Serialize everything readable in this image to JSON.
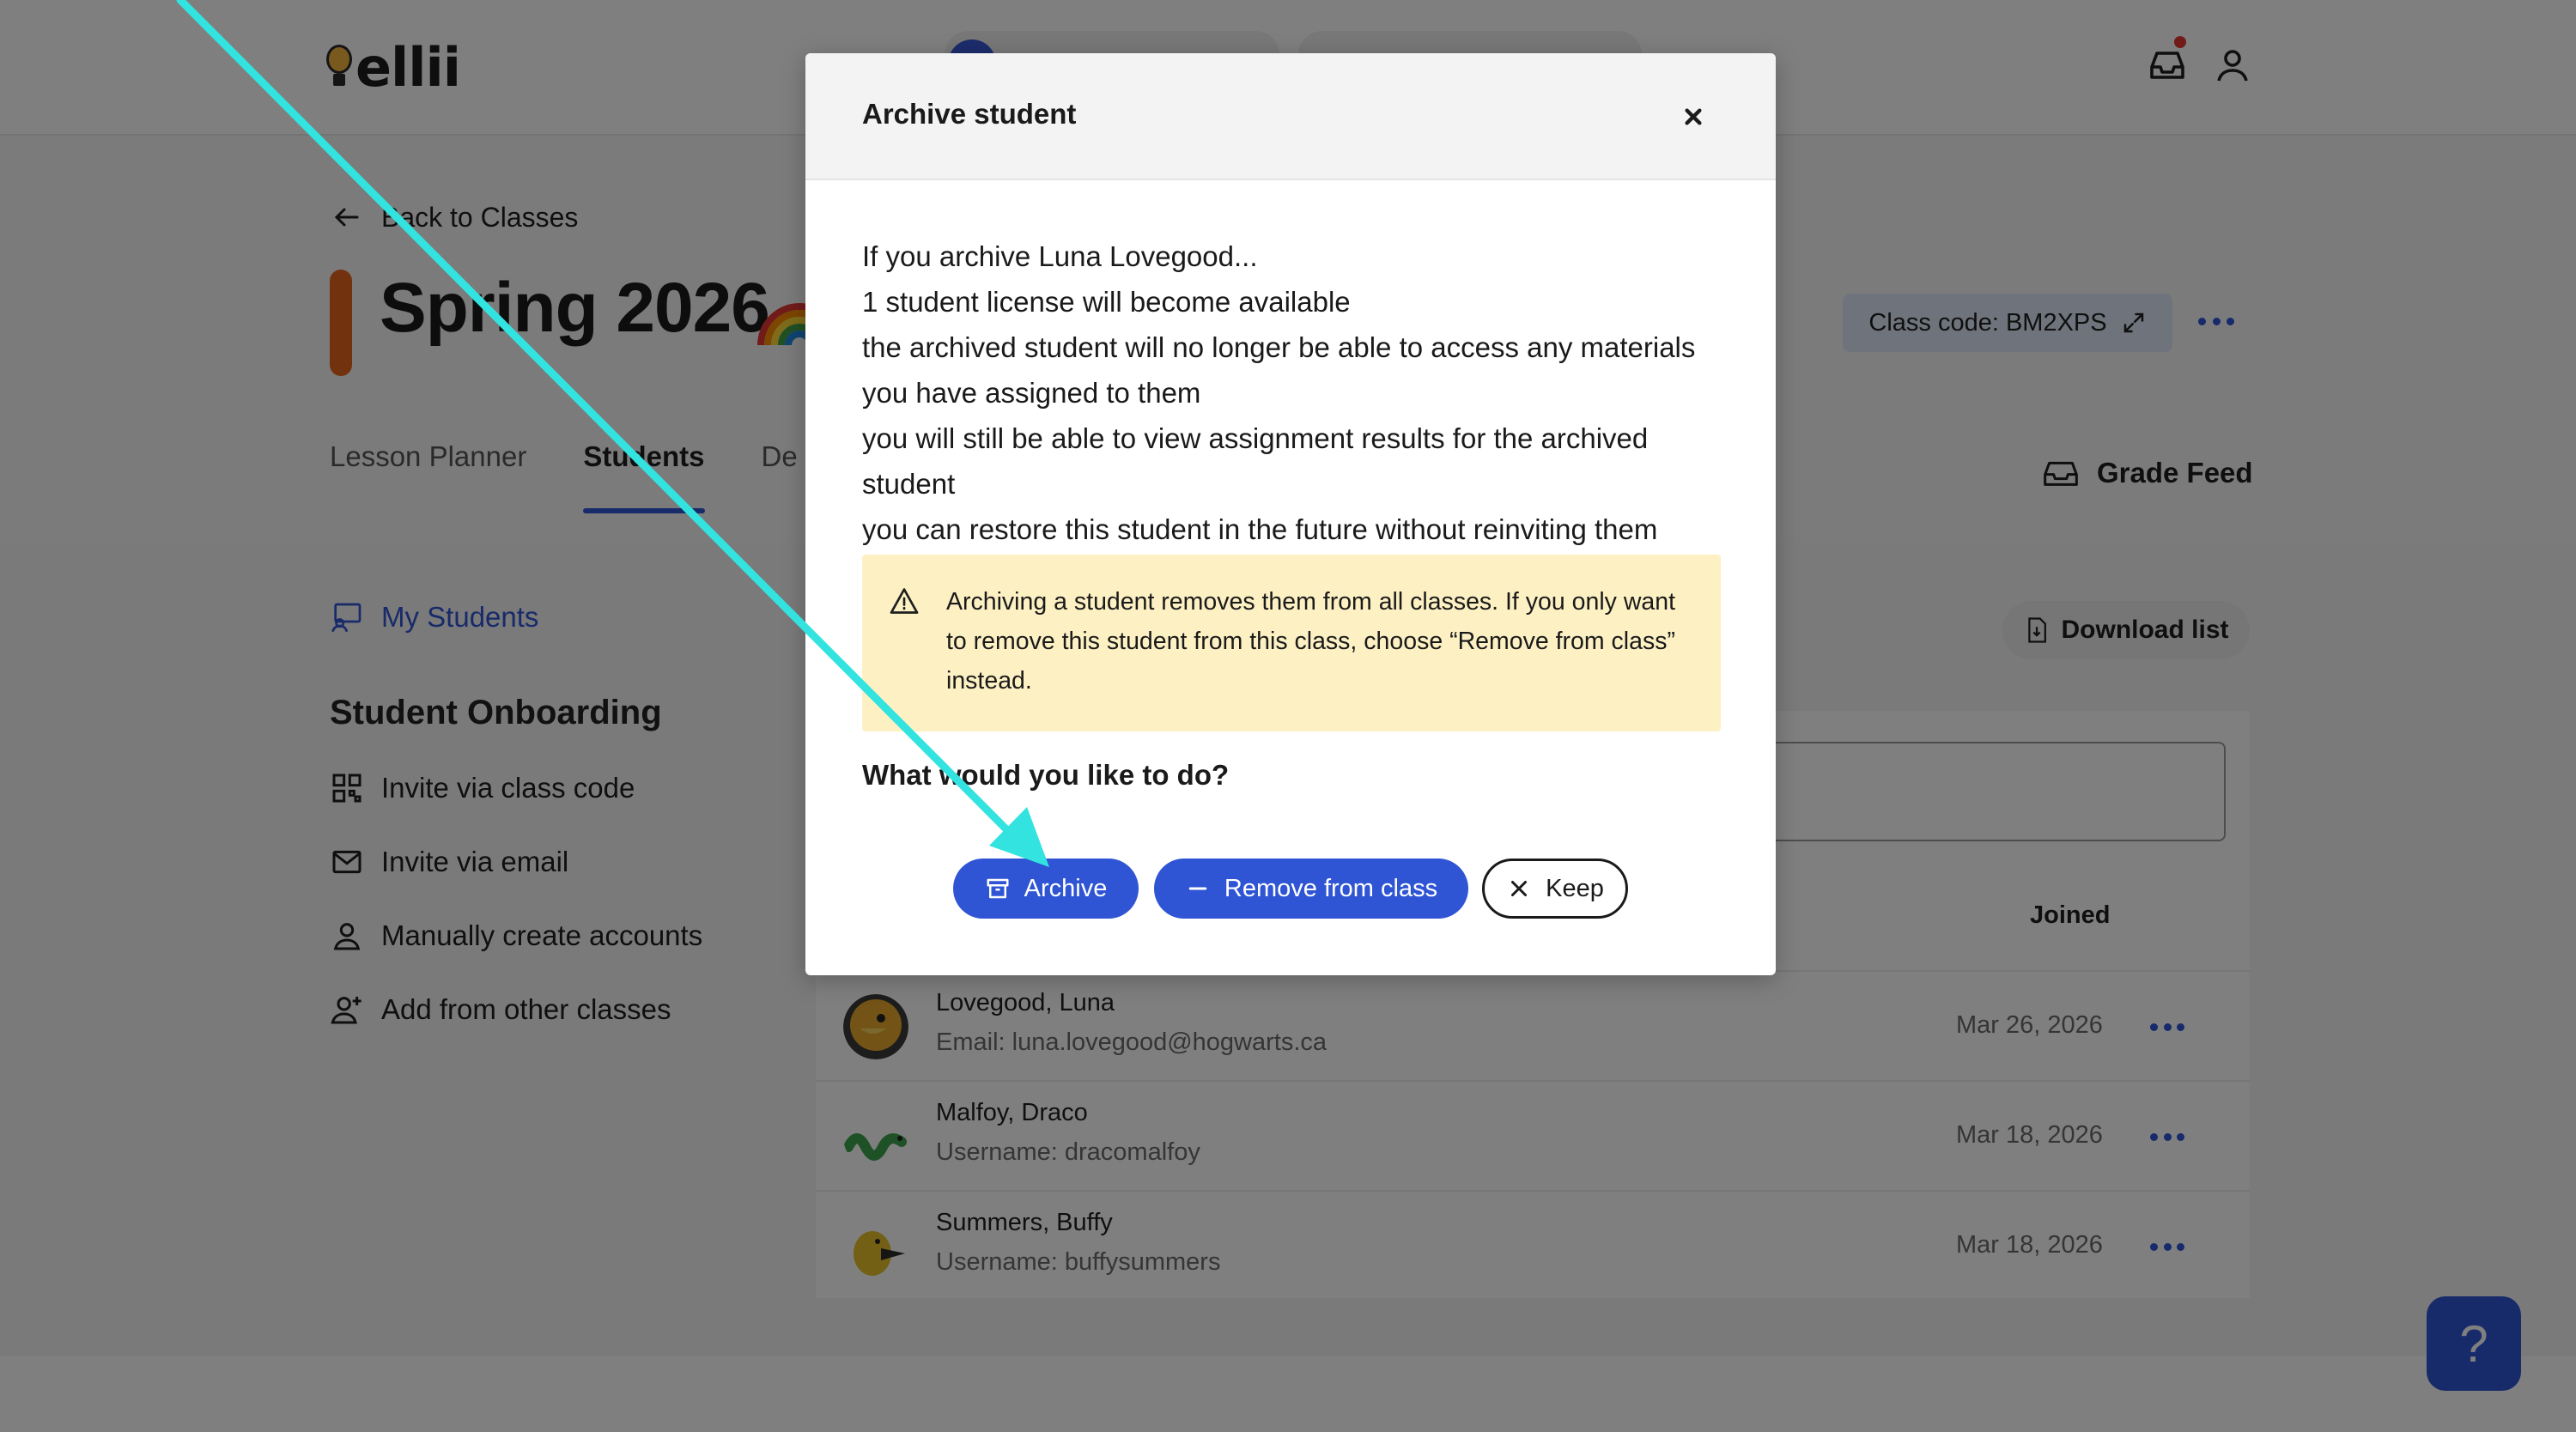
{
  "app": {
    "logo_text": "ellii"
  },
  "header": {
    "back_label": "Back to Classes",
    "class_title": "Spring 2026",
    "class_code_label": "Class code: BM2XPS",
    "grade_feed_label": "Grade Feed"
  },
  "tabs": [
    {
      "label": "Lesson Planner",
      "active": false
    },
    {
      "label": "Students",
      "active": true
    },
    {
      "label": "De",
      "active": false
    }
  ],
  "sidebar": {
    "my_students": "My Students",
    "onboarding_title": "Student Onboarding",
    "items": [
      {
        "label": "Invite via class code",
        "icon": "qr-code-icon"
      },
      {
        "label": "Invite via email",
        "icon": "envelope-icon"
      },
      {
        "label": "Manually create accounts",
        "icon": "person-icon"
      },
      {
        "label": "Add from other classes",
        "icon": "person-add-icon"
      }
    ]
  },
  "students_panel": {
    "download_label": "Download list",
    "joined_header": "Joined",
    "rows": [
      {
        "name": "Lovegood, Luna",
        "sub": "Email: luna.lovegood@hogwarts.ca",
        "date": "Mar 26, 2026",
        "avatar_color": "#e8a82c"
      },
      {
        "name": "Malfoy, Draco",
        "sub": "Username: dracomalfoy",
        "date": "Mar 18, 2026",
        "avatar_color": "#3fa34d"
      },
      {
        "name": "Summers, Buffy",
        "sub": "Username: buffysummers",
        "date": "Mar 18, 2026",
        "avatar_color": "#e6c12b"
      }
    ]
  },
  "help_label": "?",
  "modal": {
    "title": "Archive student",
    "lines": [
      "If you archive Luna Lovegood...",
      "1 student license will become available",
      "the archived student will no longer be able to access any materials you have assigned to them",
      "you will still be able to view assignment results for the archived student",
      "you can restore this student in the future without reinviting them"
    ],
    "warning": "Archiving a student removes them from all classes. If you only want to remove this student from this class, choose “Remove from class” instead.",
    "prompt": "What would you like to do?",
    "buttons": {
      "archive": "Archive",
      "remove": "Remove from class",
      "keep": "Keep"
    }
  },
  "colors": {
    "accent": "#2f55d4",
    "class_bar": "#e5641d",
    "warning_bg": "#fdf1c4",
    "annotation_arrow": "#33e3e0"
  }
}
